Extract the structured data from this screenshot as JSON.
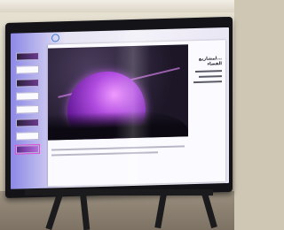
{
  "scene": {
    "screen_accent": "#8c88e6",
    "highlight": "#e14bd6",
    "planet_color": "#b04ce0"
  },
  "app": {
    "toolbar_icon": "cloud-sync-icon",
    "thumbnails": [
      {
        "style": "dark"
      },
      {
        "style": "light"
      },
      {
        "style": "dark"
      },
      {
        "style": "light"
      },
      {
        "style": "light"
      },
      {
        "style": "dark"
      },
      {
        "style": "light"
      },
      {
        "style": "purple"
      }
    ]
  },
  "slide": {
    "title": "...لمشاريع الفضاء",
    "subtitle": ""
  }
}
